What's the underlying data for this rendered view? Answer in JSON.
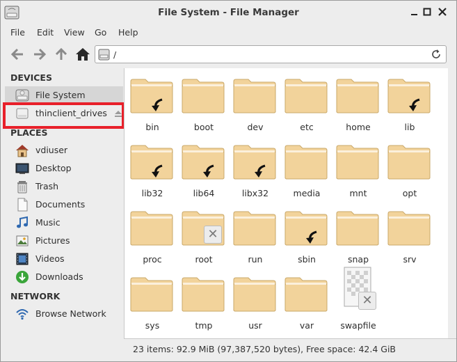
{
  "window": {
    "title": "File System - File Manager",
    "controls": [
      "minimize",
      "maximize",
      "close"
    ]
  },
  "menubar": {
    "items": [
      "File",
      "Edit",
      "View",
      "Go",
      "Help"
    ]
  },
  "toolbar": {
    "buttons": [
      "back-icon",
      "forward-icon",
      "up-icon",
      "home-icon"
    ],
    "location": "/"
  },
  "sidebar": {
    "devices_heading": "DEVICES",
    "devices": [
      {
        "label": "File System",
        "icon": "harddisk-icon",
        "selected": true
      },
      {
        "label": "thinclient_drives",
        "icon": "drive-icon",
        "ejectable": true
      }
    ],
    "places_heading": "PLACES",
    "places": [
      {
        "label": "vdiuser",
        "icon": "home-folder-icon"
      },
      {
        "label": "Desktop",
        "icon": "desktop-icon"
      },
      {
        "label": "Trash",
        "icon": "trash-icon"
      },
      {
        "label": "Documents",
        "icon": "document-icon"
      },
      {
        "label": "Music",
        "icon": "music-icon"
      },
      {
        "label": "Pictures",
        "icon": "pictures-icon"
      },
      {
        "label": "Videos",
        "icon": "videos-icon"
      },
      {
        "label": "Downloads",
        "icon": "downloads-icon"
      }
    ],
    "network_heading": "NETWORK",
    "network": [
      {
        "label": "Browse Network",
        "icon": "network-icon"
      }
    ]
  },
  "files": [
    {
      "name": "bin",
      "type": "folder",
      "symlink": true
    },
    {
      "name": "boot",
      "type": "folder"
    },
    {
      "name": "dev",
      "type": "folder"
    },
    {
      "name": "etc",
      "type": "folder"
    },
    {
      "name": "home",
      "type": "folder"
    },
    {
      "name": "lib",
      "type": "folder",
      "symlink": true
    },
    {
      "name": "lib32",
      "type": "folder",
      "symlink": true
    },
    {
      "name": "lib64",
      "type": "folder",
      "symlink": true
    },
    {
      "name": "libx32",
      "type": "folder",
      "symlink": true
    },
    {
      "name": "media",
      "type": "folder"
    },
    {
      "name": "mnt",
      "type": "folder"
    },
    {
      "name": "opt",
      "type": "folder"
    },
    {
      "name": "proc",
      "type": "folder"
    },
    {
      "name": "root",
      "type": "folder",
      "restricted": true
    },
    {
      "name": "run",
      "type": "folder"
    },
    {
      "name": "sbin",
      "type": "folder",
      "symlink": true
    },
    {
      "name": "snap",
      "type": "folder"
    },
    {
      "name": "srv",
      "type": "folder"
    },
    {
      "name": "sys",
      "type": "folder"
    },
    {
      "name": "tmp",
      "type": "folder"
    },
    {
      "name": "usr",
      "type": "folder"
    },
    {
      "name": "var",
      "type": "folder"
    },
    {
      "name": "swapfile",
      "type": "file",
      "restricted": true
    }
  ],
  "status": "23 items: 92.9 MiB (97,387,520 bytes), Free space: 42.4 GiB",
  "colors": {
    "folder": "#f2d39b",
    "highlight_border": "#e8202a",
    "selected_row": "#d6d6d6"
  }
}
